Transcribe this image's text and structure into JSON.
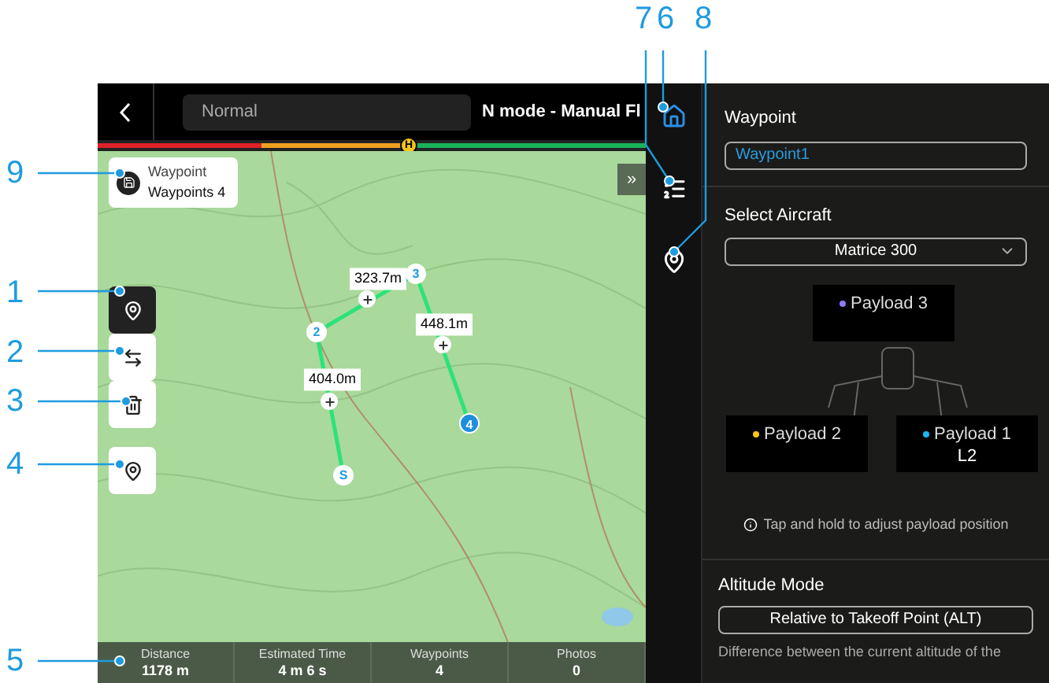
{
  "callouts": [
    {
      "label": "7"
    },
    {
      "label": "6"
    },
    {
      "label": "8"
    },
    {
      "label": "9"
    },
    {
      "label": "1"
    },
    {
      "label": "2"
    },
    {
      "label": "3"
    },
    {
      "label": "4"
    },
    {
      "label": "5"
    }
  ],
  "top_bar": {
    "mode_field": "Normal",
    "flight_mode": "N mode - Manual Fl",
    "battery_marker": "H"
  },
  "route_card": {
    "title": "Waypoint",
    "subtitle": "Waypoints 4"
  },
  "expand_button": "»",
  "tools": [
    {
      "selected": true
    },
    {
      "selected": false
    },
    {
      "selected": false
    },
    {
      "selected": false
    }
  ],
  "route": {
    "waypoints": [
      {
        "label": "S",
        "selected": false
      },
      {
        "label": "2",
        "selected": false
      },
      {
        "label": "3",
        "selected": false
      },
      {
        "label": "4",
        "selected": true
      }
    ],
    "segments": [
      {
        "distance": "404.0m"
      },
      {
        "distance": "323.7m"
      },
      {
        "distance": "448.1m"
      }
    ]
  },
  "stats": [
    {
      "label": "Distance",
      "value": "1178 m"
    },
    {
      "label": "Estimated Time",
      "value": "4 m 6 s"
    },
    {
      "label": "Waypoints",
      "value": "4"
    },
    {
      "label": "Photos",
      "value": "0"
    }
  ],
  "side_icons": [
    {
      "selected": true
    },
    {
      "selected": false
    },
    {
      "selected": false
    }
  ],
  "panel": {
    "waypoint_label": "Waypoint",
    "waypoint_name": "Waypoint1",
    "aircraft_label": "Select Aircraft",
    "aircraft": "Matrice 300",
    "payloads": [
      {
        "name": "Payload 3",
        "color": "#8b7cf6"
      },
      {
        "name": "Payload 2",
        "color": "#f5c518"
      },
      {
        "name": "Payload 1",
        "color": "#1ab8f0",
        "detail": "L2"
      }
    ],
    "hint": "Tap and hold to adjust payload position",
    "altitude_label": "Altitude Mode",
    "altitude_mode": "Relative to Takeoff Point (ALT)",
    "altitude_note": "Difference between the current altitude of the"
  }
}
